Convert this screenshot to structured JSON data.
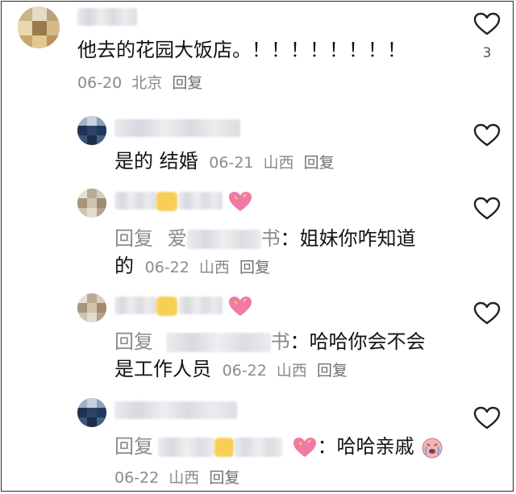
{
  "comments": [
    {
      "text": "他去的花园大饭店。！！！！！！！！",
      "date": "06-20",
      "location": "北京",
      "reply_label": "回复",
      "like_count": "3",
      "icon": "heart-outline-icon"
    },
    {
      "text": "是的 结婚",
      "date": "06-21",
      "location": "山西",
      "reply_label": "回复",
      "icon": "heart-outline-icon"
    },
    {
      "prefix": "回复",
      "target_start": "爱",
      "target_end": "书",
      "separator": "：",
      "text": "姐妹你咋知道",
      "text_cont": "的",
      "date": "06-22",
      "location": "山西",
      "reply_label": "回复",
      "icon": "heart-outline-icon"
    },
    {
      "prefix": "回复",
      "target_end": "书",
      "separator": "：",
      "text": "哈哈你会不会",
      "text_cont": "是工作人员",
      "date": "06-22",
      "location": "山西",
      "reply_label": "回复",
      "icon": "heart-outline-icon"
    },
    {
      "prefix": "回复",
      "separator": "：",
      "text": "哈哈亲戚",
      "date": "06-22",
      "location": "山西",
      "reply_label": "回复",
      "icon": "heart-outline-icon"
    }
  ],
  "colors": {
    "text": "#121212",
    "meta": "#8a8a8a",
    "heart_outline": "#222222",
    "border": "#2a2a2a"
  }
}
